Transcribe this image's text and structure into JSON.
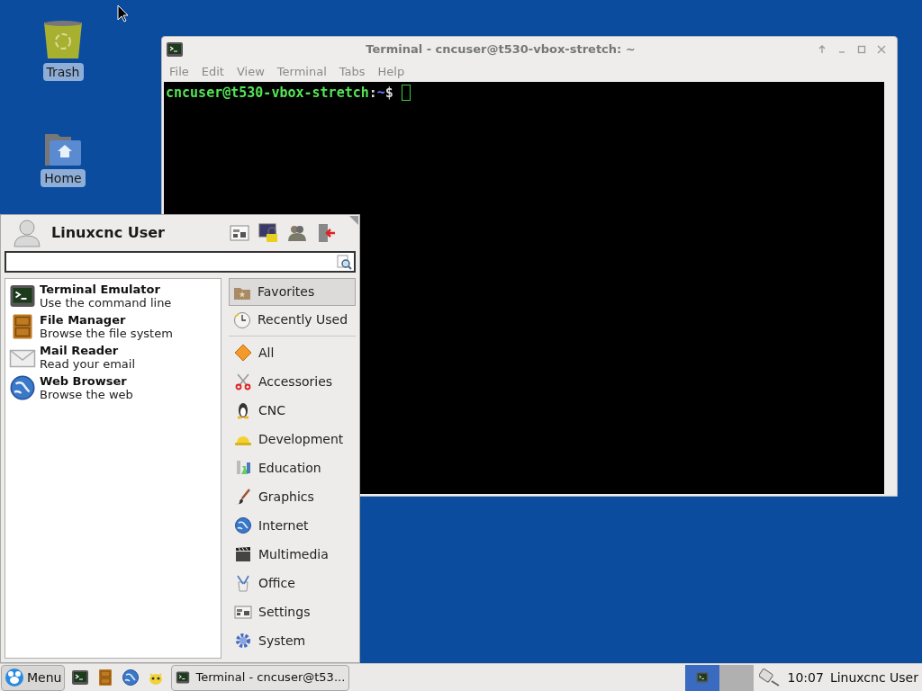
{
  "desktop_icons": [
    {
      "kind": "trash",
      "label": "Trash"
    },
    {
      "kind": "home",
      "label": "Home"
    }
  ],
  "terminal": {
    "title": "Terminal - cncuser@t530-vbox-stretch: ~",
    "menu": [
      "File",
      "Edit",
      "View",
      "Terminal",
      "Tabs",
      "Help"
    ],
    "prompt": {
      "user_host": "cncuser@t530-vbox-stretch",
      "separator": ":",
      "path": "~",
      "symbol": "$"
    }
  },
  "app_menu": {
    "user": "Linuxcnc User",
    "favorites": [
      {
        "kind": "terminal",
        "name": "Terminal Emulator",
        "description": "Use the command line"
      },
      {
        "kind": "files",
        "name": "File Manager",
        "description": "Browse the file system"
      },
      {
        "kind": "mail",
        "name": "Mail Reader",
        "description": "Read your email"
      },
      {
        "kind": "web",
        "name": "Web Browser",
        "description": "Browse the web"
      }
    ],
    "places": [
      {
        "kind": "favorites",
        "label": "Favorites",
        "selected": true
      },
      {
        "kind": "recent",
        "label": "Recently Used",
        "selected": false
      }
    ],
    "categories": [
      {
        "kind": "all",
        "label": "All",
        "selected": false
      },
      {
        "kind": "accessories",
        "label": "Accessories",
        "selected": false
      },
      {
        "kind": "cnc",
        "label": "CNC",
        "selected": false
      },
      {
        "kind": "development",
        "label": "Development",
        "selected": false
      },
      {
        "kind": "education",
        "label": "Education",
        "selected": false
      },
      {
        "kind": "graphics",
        "label": "Graphics",
        "selected": false
      },
      {
        "kind": "internet",
        "label": "Internet",
        "selected": false
      },
      {
        "kind": "multimedia",
        "label": "Multimedia",
        "selected": false
      },
      {
        "kind": "office",
        "label": "Office",
        "selected": false
      },
      {
        "kind": "settings",
        "label": "Settings",
        "selected": false
      },
      {
        "kind": "system",
        "label": "System",
        "selected": false
      }
    ]
  },
  "taskbar": {
    "menu_label": "Menu",
    "launchers": [
      {
        "kind": "terminal"
      },
      {
        "kind": "files"
      },
      {
        "kind": "web"
      },
      {
        "kind": "mascot"
      }
    ],
    "tasks": [
      {
        "label": "Terminal - cncuser@t53...",
        "selected": false
      }
    ],
    "workspaces": [
      {
        "selected": true
      },
      {
        "selected": false
      }
    ],
    "clock": "10:07",
    "user": "Linuxcnc User"
  }
}
